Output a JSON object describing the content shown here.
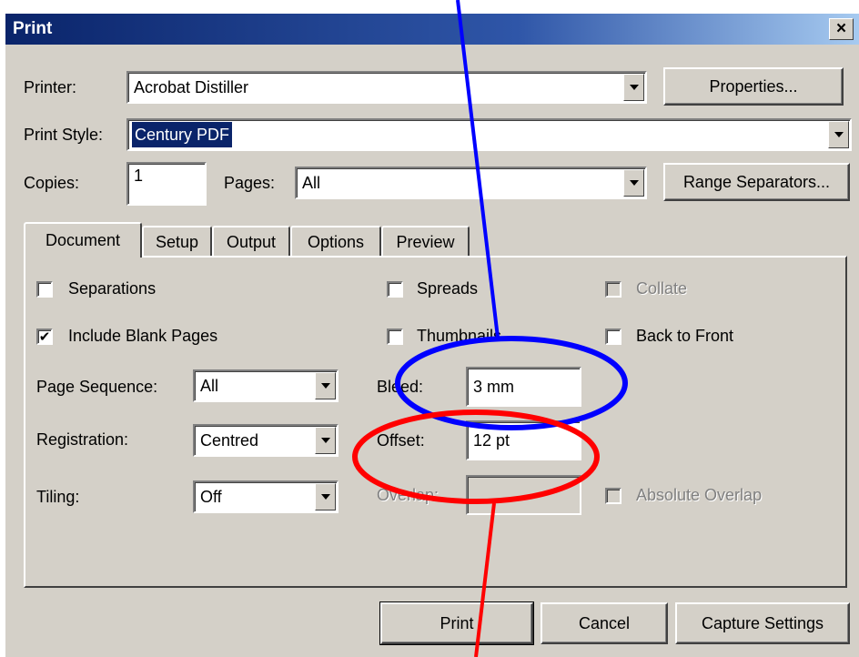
{
  "dialog": {
    "title": "Print",
    "close_glyph": "×",
    "printer": {
      "label": "Printer:",
      "value": "Acrobat Distiller"
    },
    "properties_button": "Properties...",
    "print_style": {
      "label": "Print Style:",
      "value": "Century PDF"
    },
    "copies": {
      "label": "Copies:",
      "value": "1"
    },
    "pages": {
      "label": "Pages:",
      "value": "All"
    },
    "range_separators_button": "Range Separators...",
    "tabs": [
      {
        "label": "Document",
        "active": true
      },
      {
        "label": "Setup",
        "active": false
      },
      {
        "label": "Output",
        "active": false
      },
      {
        "label": "Options",
        "active": false
      },
      {
        "label": "Preview",
        "active": false
      }
    ],
    "document_tab": {
      "separations": {
        "label": "Separations",
        "checked": false
      },
      "include_blank_pages": {
        "label": "Include Blank Pages",
        "checked": true
      },
      "spreads": {
        "label": "Spreads",
        "checked": false
      },
      "thumbnails": {
        "label": "Thumbnails",
        "checked": false
      },
      "collate": {
        "label": "Collate",
        "checked": false,
        "disabled": true
      },
      "back_to_front": {
        "label": "Back to Front",
        "checked": false
      },
      "page_sequence": {
        "label": "Page Sequence:",
        "value": "All"
      },
      "registration": {
        "label": "Registration:",
        "value": "Centred"
      },
      "tiling": {
        "label": "Tiling:",
        "value": "Off"
      },
      "bleed": {
        "label": "Bleed:",
        "value": "3 mm"
      },
      "offset": {
        "label": "Offset:",
        "value": "12 pt"
      },
      "overlap": {
        "label": "Overlap:",
        "value": "",
        "disabled": true
      },
      "absolute_overlap": {
        "label": "Absolute Overlap",
        "checked": false,
        "disabled": true
      }
    },
    "buttons": {
      "print": "Print",
      "cancel": "Cancel",
      "capture_settings": "Capture Settings"
    },
    "check_glyph": "✔"
  },
  "annotations": {
    "blue_color": "#0000ff",
    "red_color": "#ff0000"
  }
}
